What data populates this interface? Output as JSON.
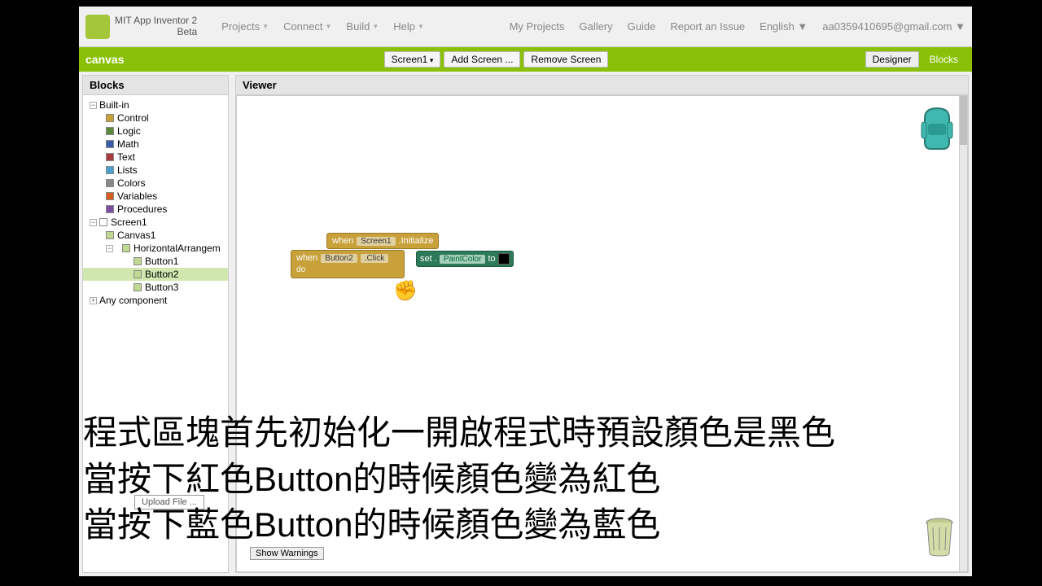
{
  "brand": {
    "line1": "MIT App Inventor 2",
    "line2": "Beta"
  },
  "menu": {
    "projects": "Projects",
    "connect": "Connect",
    "build": "Build",
    "help": "Help"
  },
  "topright": {
    "myprojects": "My Projects",
    "gallery": "Gallery",
    "guide": "Guide",
    "report": "Report an Issue",
    "language": "English",
    "email": "aa0359410695@gmail.com"
  },
  "greenbar": {
    "project": "canvas",
    "screenSel": "Screen1",
    "addScreen": "Add Screen ...",
    "removeScreen": "Remove Screen",
    "designer": "Designer",
    "blocks": "Blocks"
  },
  "sidebar": {
    "title": "Blocks",
    "builtin": "Built-in",
    "items": {
      "control": "Control",
      "logic": "Logic",
      "math": "Math",
      "text": "Text",
      "lists": "Lists",
      "colors": "Colors",
      "variables": "Variables",
      "procedures": "Procedures"
    },
    "screen1": "Screen1",
    "canvas1": "Canvas1",
    "harr": "HorizontalArrangem",
    "b1": "Button1",
    "b2": "Button2",
    "b3": "Button3",
    "anycomp": "Any component"
  },
  "viewer": {
    "title": "Viewer",
    "showWarnings": "Show Warnings",
    "uploadFile": "Upload File ..."
  },
  "blocks": {
    "when": "when",
    "screen1": "Screen1",
    "initialize": ".Initialize",
    "button2": "Button2",
    "click": ".Click",
    "do": "do",
    "set": "set",
    "paintcolor": "PaintColor",
    "to": "to"
  },
  "overlay": "程式區塊首先初始化一開啟程式時預設顏色是黑色\n當按下紅色Button的時候顏色變為紅色\n當按下藍色Button的時候顏色變為藍色"
}
